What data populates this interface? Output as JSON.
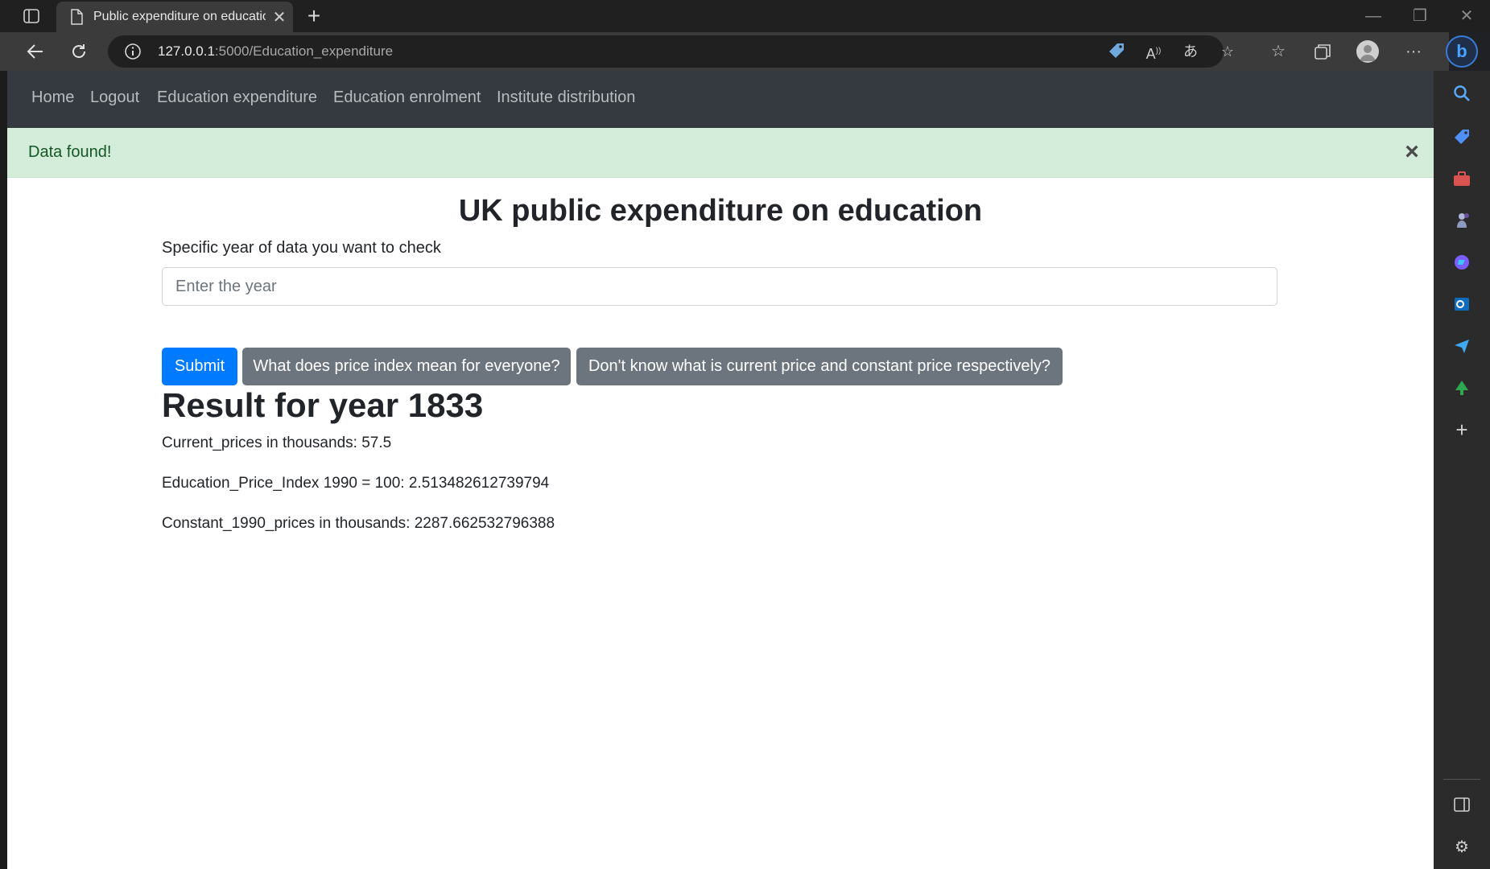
{
  "browser": {
    "tab_title": "Public expenditure on education",
    "new_tab_symbol": "+",
    "url_host": "127.0.0.1",
    "url_rest": ":5000/Education_expenditure",
    "window_controls": {
      "minimize": "—",
      "restore": "❐",
      "close": "✕"
    },
    "icons": {
      "tab_actions": "tab-actions-icon",
      "page": "page-icon",
      "back": "back-arrow-icon",
      "refresh": "refresh-icon",
      "site_info": "info-icon",
      "tag": "price-tag-icon",
      "read_aloud": "read-aloud-icon",
      "translate": "translate-icon",
      "add_favorite": "add-favorite-icon",
      "favorites": "favorites-icon",
      "collections": "collections-icon",
      "profile": "profile-icon",
      "more": "more-icon",
      "copilot": "bing-copilot-icon"
    },
    "sidebar_icons": [
      "search-icon",
      "shopping-tag-icon",
      "tools-icon",
      "games-icon",
      "copilot-app-icon",
      "outlook-icon",
      "send-icon",
      "tree-icon",
      "add-icon",
      "sidebar-toggle-icon",
      "settings-icon"
    ]
  },
  "site_nav": {
    "links": [
      "Home",
      "Logout",
      "Education expenditure",
      "Education enrolment",
      "Institute distribution"
    ]
  },
  "alert": {
    "message": "Data found!",
    "close": "×",
    "color": "#155724",
    "background": "#d4edda"
  },
  "main": {
    "title": "UK public expenditure on education",
    "field_label": "Specific year of data you want to check",
    "input_placeholder": "Enter the year",
    "input_value": "",
    "buttons": {
      "submit": "Submit",
      "price_index": "What does price index mean for everyone?",
      "current_constant": "Don't know what is current price and constant price respectively?"
    },
    "colors": {
      "primary": "#007bff",
      "secondary": "#6c757d"
    },
    "result": {
      "heading": "Result for year 1833",
      "lines": [
        "Current_prices in thousands: 57.5",
        "Education_Price_Index 1990 = 100: 2.513482612739794",
        "Constant_1990_prices in thousands: 2287.662532796388"
      ]
    }
  }
}
